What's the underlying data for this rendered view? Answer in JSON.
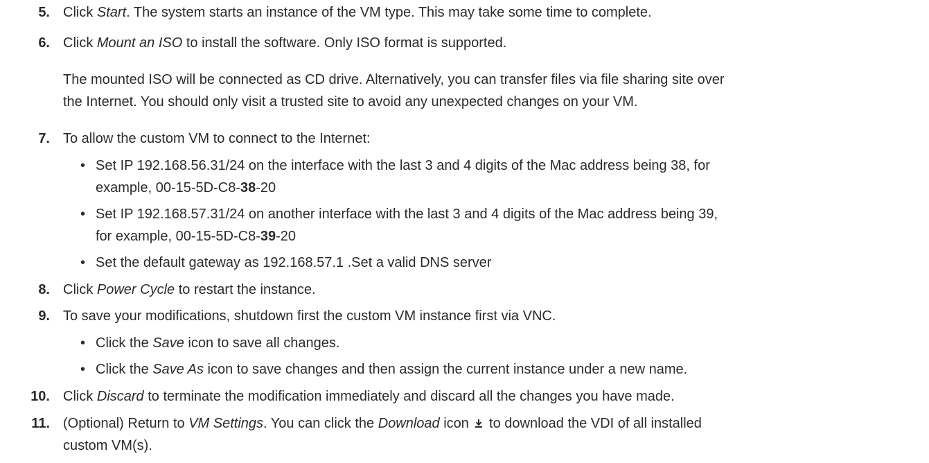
{
  "steps": [
    {
      "num": "5.",
      "pre": "Click ",
      "em": "Start",
      "post": ". The system starts an instance of the VM type. This may take some time to complete."
    },
    {
      "num": "6.",
      "pre": "Click ",
      "em": "Mount an ISO",
      "post": " to install the software. Only ISO format is supported.",
      "note_line1": "The mounted ISO will be connected as CD drive. Alternatively, you can transfer files via file sharing site over",
      "note_line2": "the Internet. You should only visit a trusted site to avoid any unexpected changes on your VM."
    },
    {
      "num": "7.",
      "text": "To allow the custom VM to connect to the Internet:",
      "bullets": [
        {
          "line1": "Set IP 192.168.56.31/24 on the interface with the last 3 and 4 digits of the Mac address being 38, for",
          "line2_pre": "example, 00-15-5D-C8-",
          "line2_bold": "38",
          "line2_post": "-20"
        },
        {
          "line1": "Set IP 192.168.57.31/24 on another interface with the last 3 and 4 digits of the Mac address being 39,",
          "line2_pre": "for example, 00-15-5D-C8-",
          "line2_bold": "39",
          "line2_post": "-20"
        },
        {
          "line1": "Set the default gateway as 192.168.57.1 .Set a valid DNS server"
        }
      ]
    },
    {
      "num": "8.",
      "pre": "Click ",
      "em": "Power Cycle",
      "post": " to restart the instance."
    },
    {
      "num": "9.",
      "text": "To save your modifications, shutdown first the custom VM instance first via VNC.",
      "bullets": [
        {
          "pre": "Click the ",
          "em": "Save",
          "post": " icon to save all changes."
        },
        {
          "pre": "Click the ",
          "em": "Save As",
          "post": " icon to save changes and then assign the current instance under a new name."
        }
      ]
    },
    {
      "num": "10.",
      "pre": "Click ",
      "em": "Discard",
      "post": " to terminate the modification immediately and discard all the changes you have made."
    },
    {
      "num": "11.",
      "pre": "(Optional) Return to ",
      "em": "VM Settings",
      "mid": ". You can click the ",
      "em2": "Download",
      "mid2": " icon ",
      "icon": "download-icon",
      "post": " to download the VDI of all installed",
      "line2": "custom VM(s)."
    }
  ],
  "bullet_glyph": "•"
}
